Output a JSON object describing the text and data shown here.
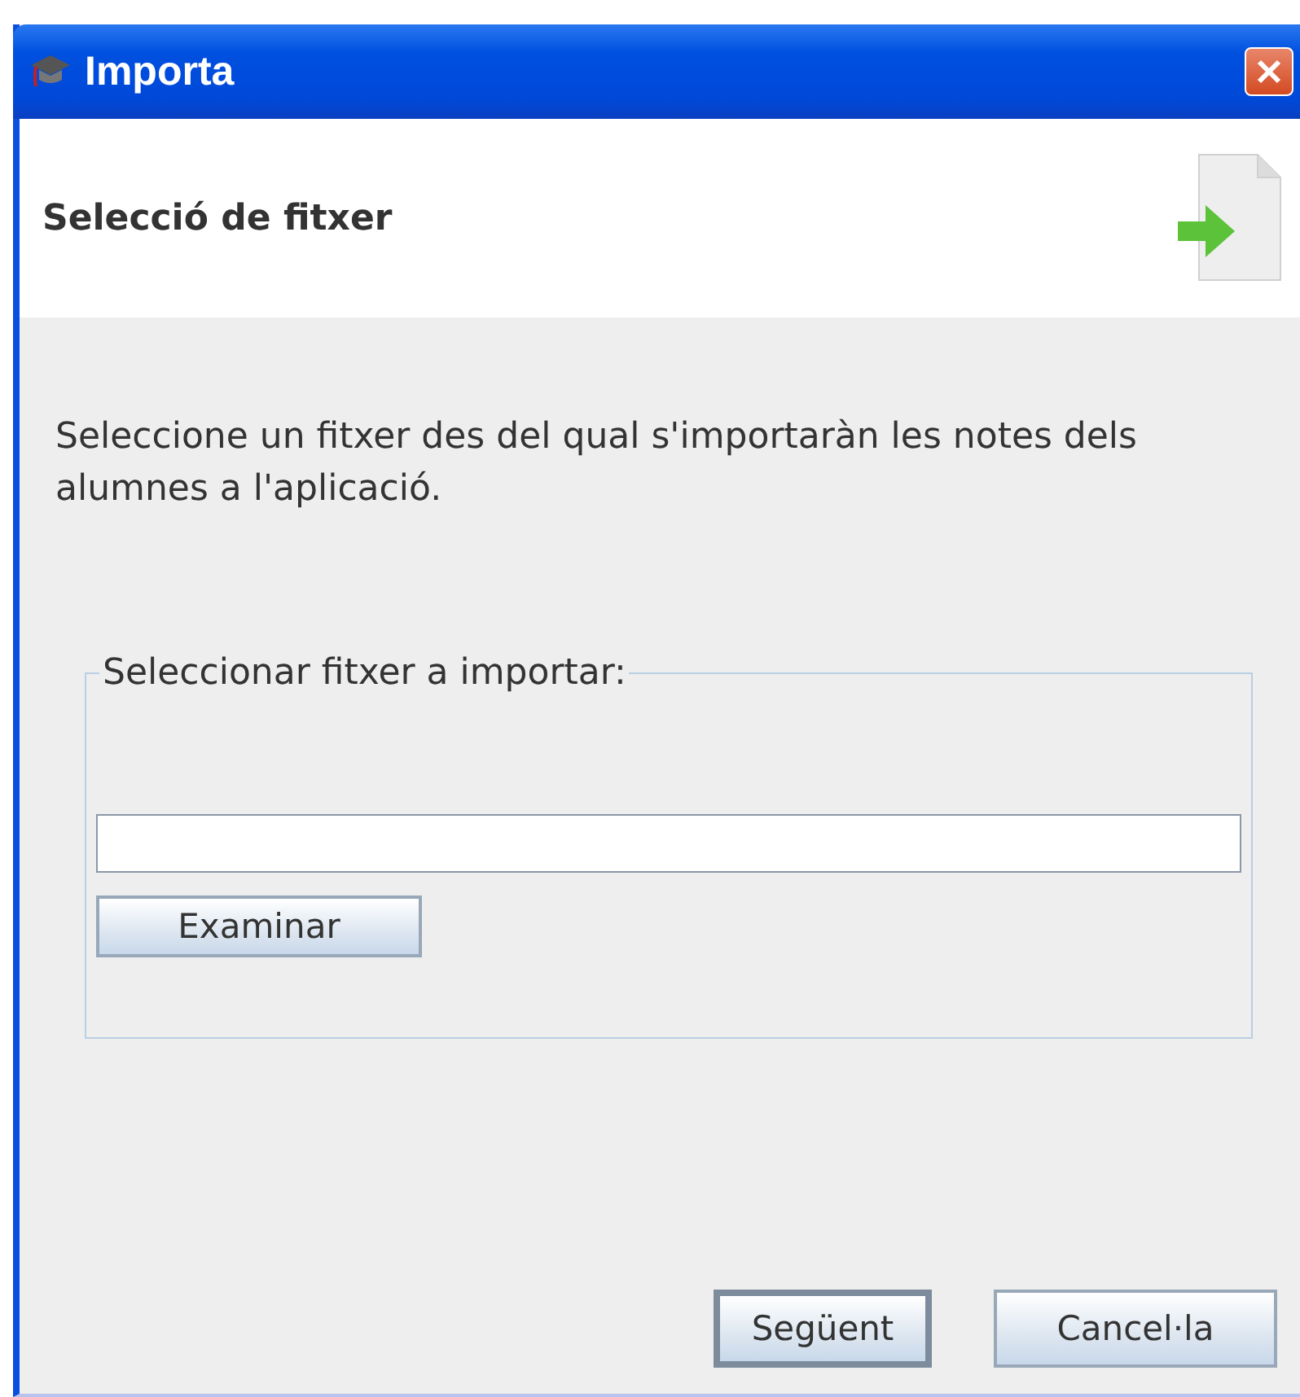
{
  "window": {
    "title": "Importa"
  },
  "header": {
    "title": "Selecció de fitxer"
  },
  "description": "Seleccione un fitxer des del qual s'importaràn les notes dels alumnes a l'aplicació.",
  "file_group": {
    "legend": "Seleccionar fitxer a importar:",
    "browse_button": "Examinar"
  },
  "buttons": [
    {
      "label": "Següent",
      "default": true
    },
    {
      "label": "Cancel·la",
      "default": false
    }
  ]
}
